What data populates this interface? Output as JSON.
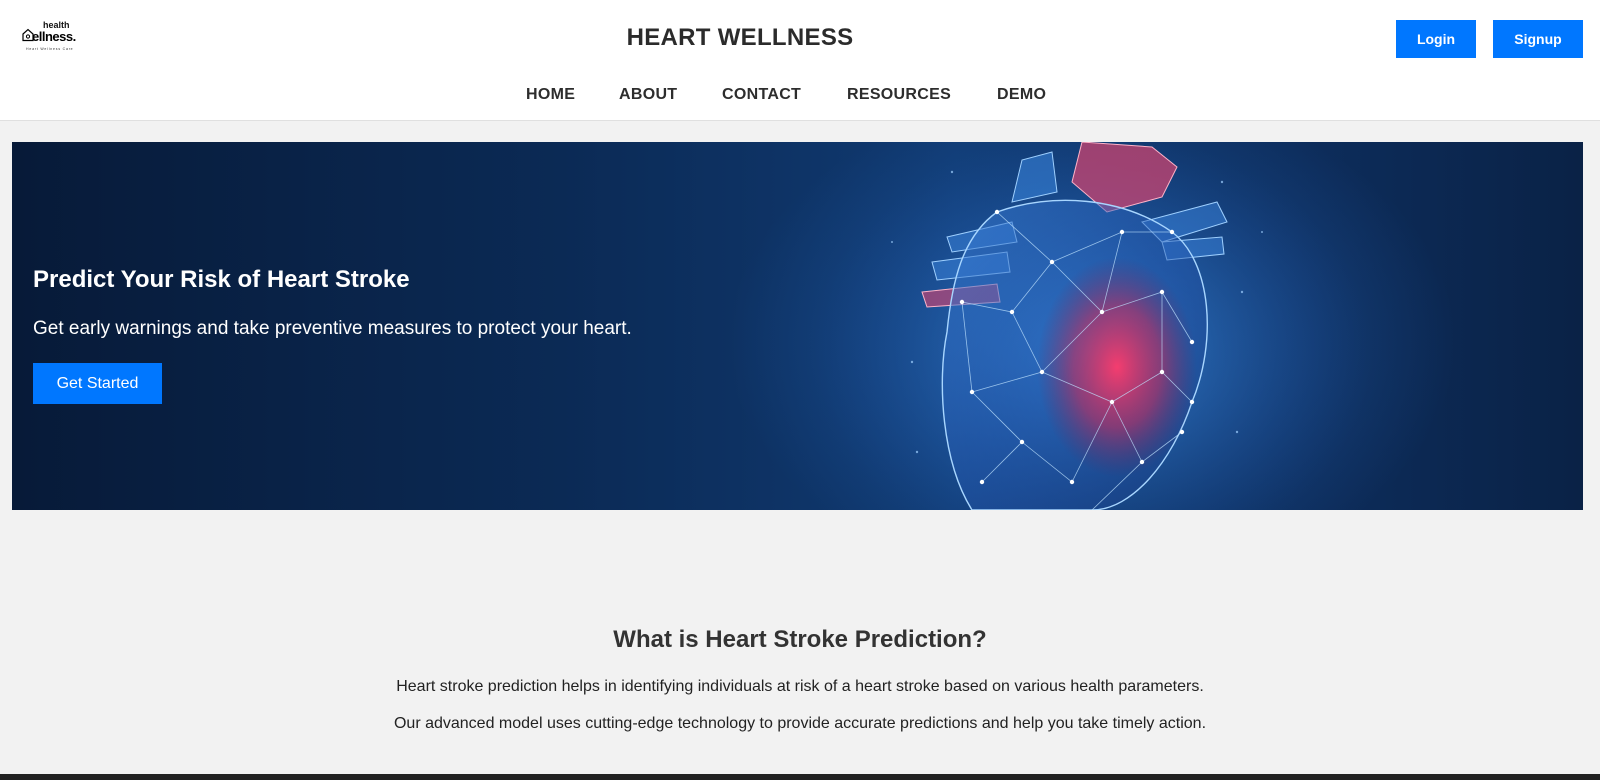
{
  "logo": {
    "top_text": "health",
    "main_text": "ellness.",
    "sub_text": "Heart Wellness Care"
  },
  "header": {
    "title": "HEART WELLNESS",
    "login_label": "Login",
    "signup_label": "Signup"
  },
  "nav": {
    "items": [
      "HOME",
      "ABOUT",
      "CONTACT",
      "RESOURCES",
      "DEMO"
    ]
  },
  "hero": {
    "title": "Predict Your Risk of Heart Stroke",
    "subtitle": "Get early warnings and take preventive measures to protect your heart.",
    "button_label": "Get Started"
  },
  "info": {
    "heading": "What is Heart Stroke Prediction?",
    "paragraphs": [
      "Heart stroke prediction helps in identifying individuals at risk of a heart stroke based on various health parameters.",
      "Our advanced model uses cutting-edge technology to provide accurate predictions and help you take timely action."
    ]
  },
  "colors": {
    "accent": "#0077ff",
    "hero_bg": "#0b2a55",
    "page_bg": "#f2f2f2"
  }
}
